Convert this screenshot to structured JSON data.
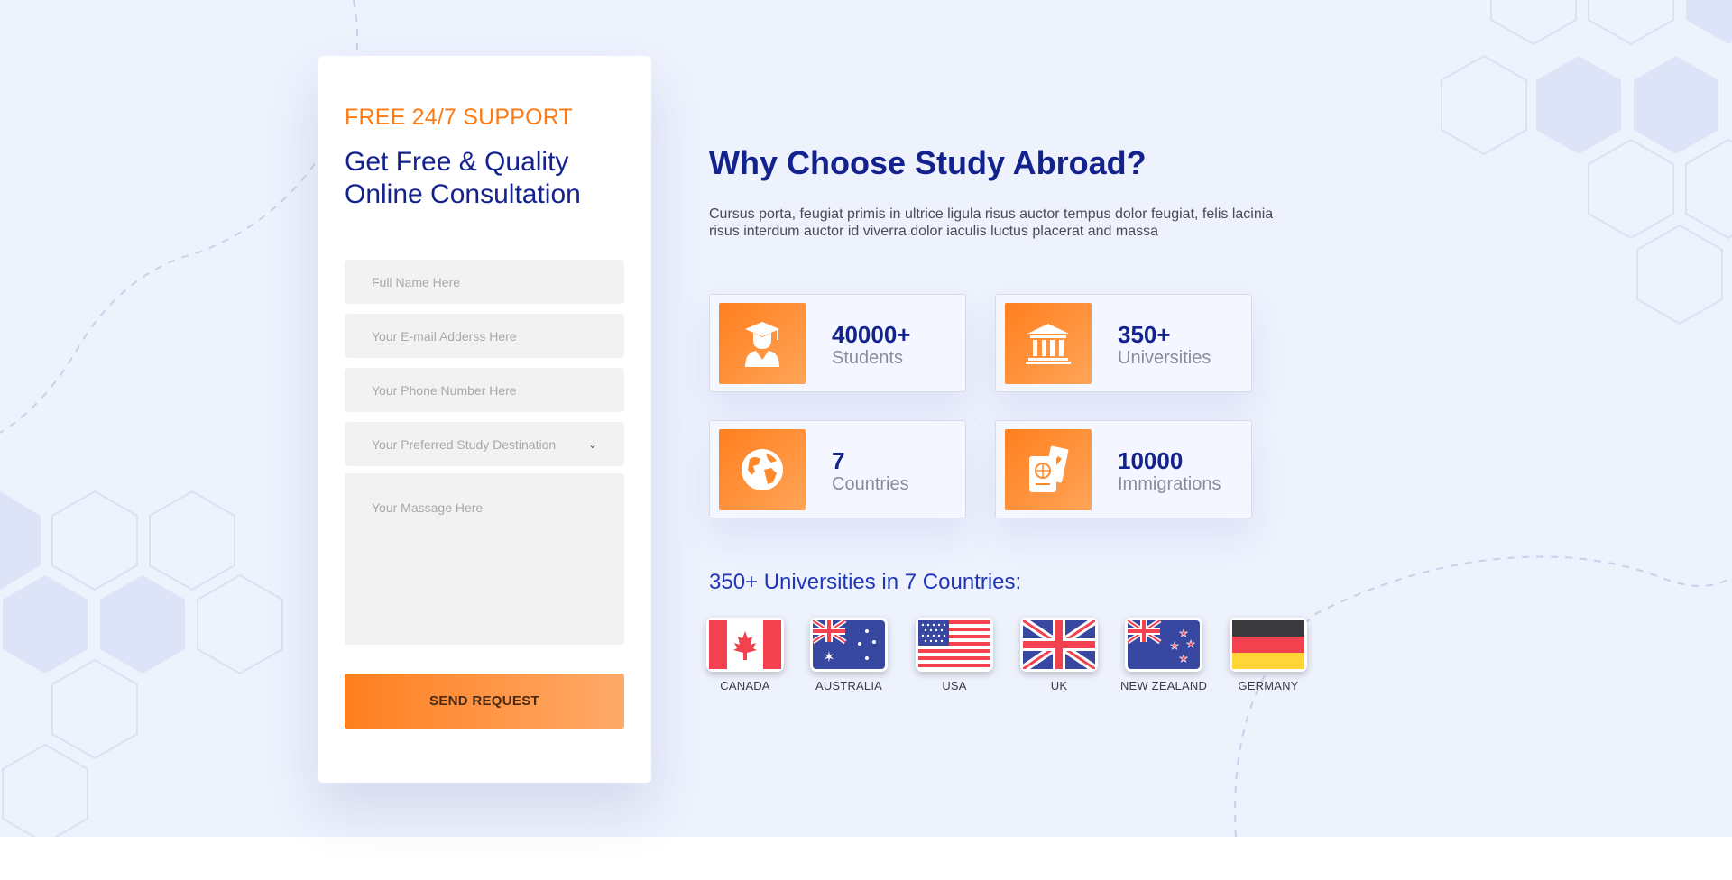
{
  "form": {
    "kicker": "FREE 24/7 SUPPORT",
    "title": "Get Free & Quality Online Consultation",
    "name_placeholder": "Full Name Here",
    "email_placeholder": "Your E-mail Adderss Here",
    "phone_placeholder": "Your Phone Number Here",
    "destination_selected": "Your Preferred Study Destination",
    "message_placeholder": "Your Massage Here",
    "submit_label": "SEND REQUEST"
  },
  "main": {
    "title": "Why Choose Study Abroad?",
    "description": "Cursus porta, feugiat primis in ultrice ligula risus auctor tempus dolor feugiat, felis lacinia risus interdum auctor id viverra dolor iaculis luctus placerat and massa"
  },
  "stats": [
    {
      "value": "40000+",
      "label": "Students",
      "icon": "graduate-icon"
    },
    {
      "value": "350+",
      "label": "Universities",
      "icon": "university-building-icon"
    },
    {
      "value": "7",
      "label": "Countries",
      "icon": "globe-icon"
    },
    {
      "value": "10000",
      "label": "Immigrations",
      "icon": "passport-ticket-icon"
    }
  ],
  "countries": {
    "title": "350+ Universities in 7 Countries:",
    "items": [
      {
        "label": "CANADA"
      },
      {
        "label": "AUSTRALIA"
      },
      {
        "label": "USA"
      },
      {
        "label": "UK"
      },
      {
        "label": "NEW ZEALAND"
      },
      {
        "label": "GERMANY"
      }
    ]
  },
  "colors": {
    "accent": "#ff7a14",
    "brand": "#14228d",
    "background": "#eef2fd"
  }
}
